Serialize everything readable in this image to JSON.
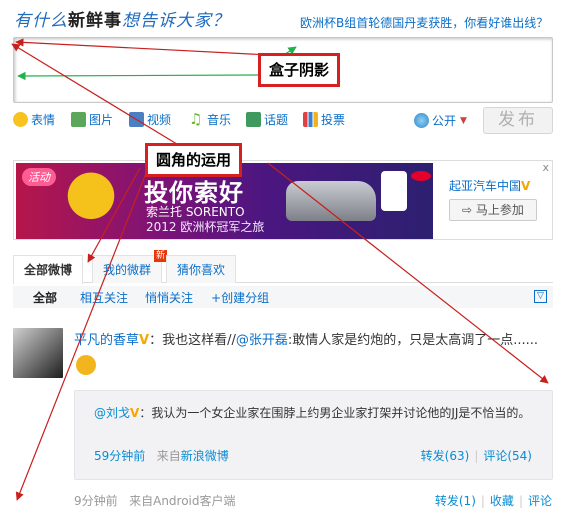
{
  "header": {
    "title_prefix": "有什么",
    "title_emph": "新鲜事",
    "title_suffix": "想告诉大家？",
    "topic": "欧洲杯B组首轮德国丹麦获胜，你看好谁出线？"
  },
  "annotations": {
    "box_shadow": "盒子阴影",
    "rounded_corners": "圆角的运用"
  },
  "toolbar": {
    "items": [
      "表情",
      "图片",
      "视频",
      "音乐",
      "话题",
      "投票"
    ],
    "visibility": "公开",
    "publish_label": "发布"
  },
  "ad": {
    "badge": "活动",
    "headline": "投你索好",
    "sub1": "索兰托 SORENTO",
    "sub2": "2012 欧洲杯冠军之旅",
    "brand": "起亚汽车中国",
    "join_label": "马上参加",
    "close": "x"
  },
  "tabs": {
    "items": [
      "全部微博",
      "我的微群",
      "猜你喜欢"
    ],
    "new_badge": "新"
  },
  "subtabs": {
    "items": [
      "全部",
      "相互关注",
      "悄悄关注",
      "创建分组"
    ]
  },
  "post": {
    "author": "平凡的香草",
    "text_before": "：我也这样看//",
    "mention": "@张开磊",
    "text_after": ":敢情人家是约炮的，只是太高调了一点......",
    "time": "9分钟前",
    "source_prefix": "来自",
    "source": "Android客户端",
    "actions": {
      "forward": "转发(1)",
      "favorite": "收藏",
      "comment": "评论"
    }
  },
  "repost": {
    "author": "@刘戈",
    "text": "：我认为一个女企业家在围脖上约男企业家打架并讨论他的JJ是不恰当的。",
    "time": "59分钟前",
    "source_prefix": "来自",
    "source": "新浪微博",
    "forward": "转发(63)",
    "comment": "评论(54)"
  },
  "colors": {
    "link": "#0a6ec8",
    "callout_border": "#d72020",
    "arrow": "#c8201e",
    "green_arrow": "#22b14c"
  }
}
